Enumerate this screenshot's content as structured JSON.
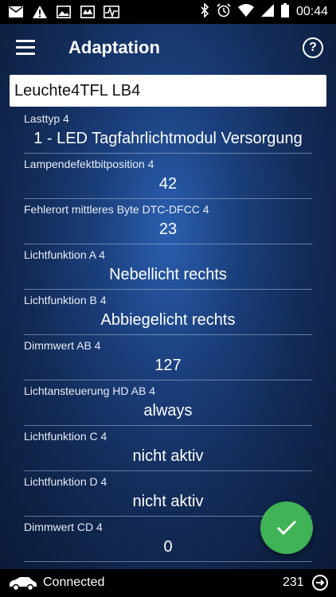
{
  "status_bar": {
    "left_icons": [
      "mail-icon",
      "warning-icon",
      "image-icon",
      "tv-icon",
      "activity-icon"
    ],
    "right_icons": [
      "bluetooth-icon",
      "alarm-icon",
      "wifi-icon",
      "signal-icon",
      "battery-icon"
    ],
    "time": "00:44"
  },
  "app_bar": {
    "title": "Adaptation",
    "menu_icon": "hamburger-menu-icon",
    "help_icon": "help-circle-icon"
  },
  "module_header": "Leuchte4TFL LB4",
  "rows": [
    {
      "label": "Lasttyp 4",
      "value": "1 - LED Tagfahrlichtmodul Versorgung"
    },
    {
      "label": "Lampendefektbitposition 4",
      "value": "42"
    },
    {
      "label": "Fehlerort mittleres Byte DTC-DFCC 4",
      "value": "23"
    },
    {
      "label": "Lichtfunktion A 4",
      "value": "Nebellicht rechts"
    },
    {
      "label": "Lichtfunktion B 4",
      "value": "Abbiegelicht rechts"
    },
    {
      "label": "Dimmwert AB 4",
      "value": "127"
    },
    {
      "label": "Lichtansteuerung HD AB 4",
      "value": "always"
    },
    {
      "label": "Lichtfunktion C 4",
      "value": "nicht aktiv"
    },
    {
      "label": "Lichtfunktion D 4",
      "value": "nicht aktiv"
    },
    {
      "label": "Dimmwert CD 4",
      "value": "0"
    }
  ],
  "fab": {
    "icon": "check-icon",
    "color": "#3fb356"
  },
  "bottom_bar": {
    "connection_icon": "car-icon",
    "status": "Connected",
    "count": "231",
    "cycle_icon": "cycle-icon"
  }
}
